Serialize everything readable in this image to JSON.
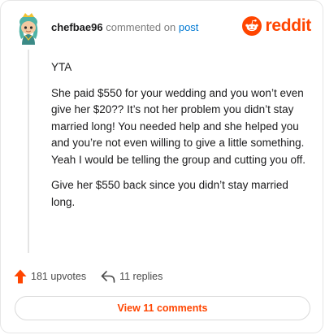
{
  "header": {
    "username": "chefbae96",
    "verb": "commented on",
    "post_link": "post",
    "logo_text": "reddit",
    "avatar_icon": "snoo-avatar-icon",
    "logo_icon": "reddit-alien-icon"
  },
  "comment": {
    "paragraphs": [
      "YTA",
      "She paid $550 for your wedding and you won’t even give her $20?? It’s not her problem you didn’t stay married long! You needed help and she helped you and you’re not even willing to give a little something. Yeah I would be telling the group and cutting you off.",
      "Give her $550 back since you didn’t stay married long."
    ]
  },
  "actions": {
    "upvotes": "181 upvotes",
    "replies": "11 replies",
    "upvote_icon": "upvote-arrow-icon",
    "reply_icon": "reply-arrow-icon"
  },
  "view_button": {
    "label": "View 11 comments"
  },
  "colors": {
    "brand": "#ff4500",
    "link": "#0079d3",
    "muted": "#7c7c7c"
  }
}
